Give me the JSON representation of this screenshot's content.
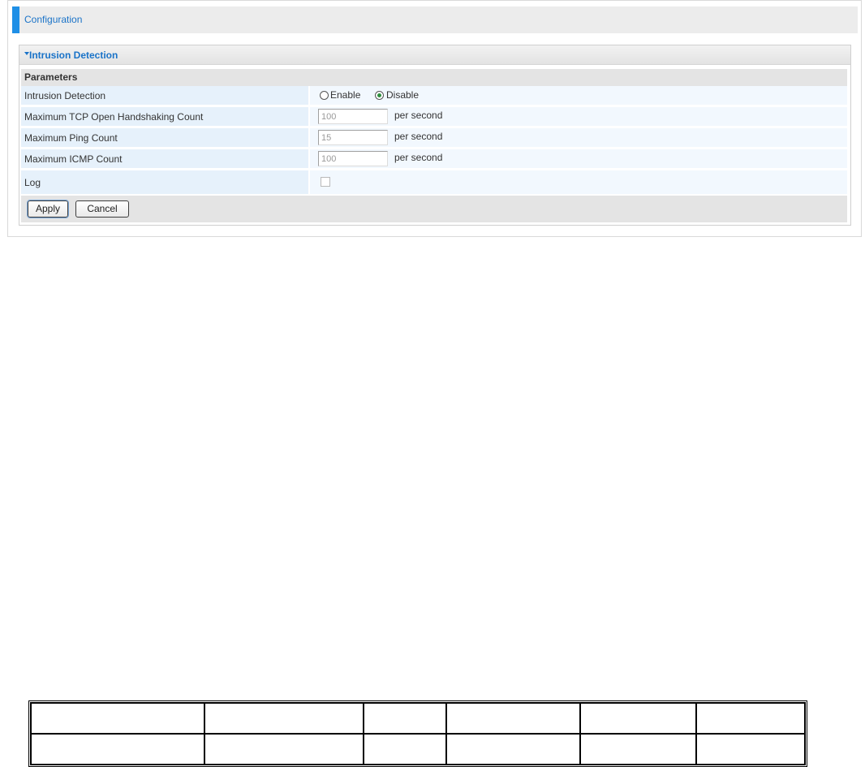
{
  "header": {
    "title": "Configuration"
  },
  "section": {
    "title": "Intrusion Detection",
    "params_heading": "Parameters"
  },
  "rows": {
    "intrusion": {
      "label": "Intrusion Detection",
      "enable_label": "Enable",
      "disable_label": "Disable",
      "selected": "Disable"
    },
    "tcp": {
      "label": "Maximum TCP Open Handshaking Count",
      "value": "100",
      "unit": "per second"
    },
    "ping": {
      "label": "Maximum Ping Count",
      "value": "15",
      "unit": "per second"
    },
    "icmp": {
      "label": "Maximum ICMP Count",
      "value": "100",
      "unit": "per second"
    },
    "log": {
      "label": "Log",
      "checked": false
    }
  },
  "buttons": {
    "apply": "Apply",
    "cancel": "Cancel"
  },
  "colors": {
    "accent": "#1f8fe6",
    "title_blue": "#1a73c8",
    "label_bg": "#e6f1fb",
    "value_bg": "#f2f8fe"
  },
  "icons": {
    "section_toggle": "triangle-down-icon"
  }
}
